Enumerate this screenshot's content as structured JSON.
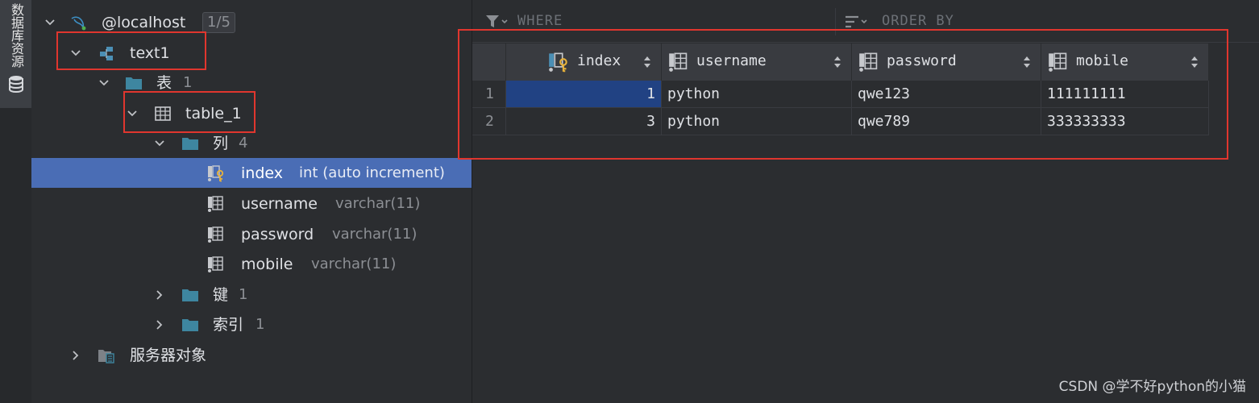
{
  "sidebar_strip": {
    "label": "数据库资源",
    "icon": "database-icon"
  },
  "tree": {
    "connection": {
      "label": "@localhost",
      "badge": "1/5",
      "icon": "mysql-dolphin-icon"
    },
    "schema": {
      "label": "text1",
      "icon": "schema-icon"
    },
    "tables_folder": {
      "label": "表",
      "count": "1"
    },
    "table": {
      "label": "table_1",
      "icon": "table-icon"
    },
    "columns_folder": {
      "label": "列",
      "count": "4"
    },
    "columns": [
      {
        "name": "index",
        "type": "int (auto increment)",
        "icon": "primary-key-column-icon",
        "selected": true
      },
      {
        "name": "username",
        "type": "varchar(11)",
        "icon": "column-icon"
      },
      {
        "name": "password",
        "type": "varchar(11)",
        "icon": "column-icon"
      },
      {
        "name": "mobile",
        "type": "varchar(11)",
        "icon": "column-icon"
      }
    ],
    "keys_folder": {
      "label": "键",
      "count": "1"
    },
    "indexes_folder": {
      "label": "索引",
      "count": "1"
    },
    "server_objects": {
      "label": "服务器对象",
      "icon": "server-objects-icon"
    }
  },
  "filter_bar": {
    "where_label": "WHERE",
    "order_label": "ORDER BY"
  },
  "grid": {
    "columns": [
      "index",
      "username",
      "password",
      "mobile"
    ],
    "rows": [
      {
        "rownum": "1",
        "index": "1",
        "username": "python",
        "password": "qwe123",
        "mobile": "111111111"
      },
      {
        "rownum": "2",
        "index": "3",
        "username": "python",
        "password": "qwe789",
        "mobile": "333333333"
      }
    ]
  },
  "colors": {
    "selection": "#4a6db5",
    "cell_highlight": "#214283",
    "annotation_red": "#e0362e",
    "folder": "#3e86a0"
  },
  "watermark": "CSDN @学不好python的小猫"
}
